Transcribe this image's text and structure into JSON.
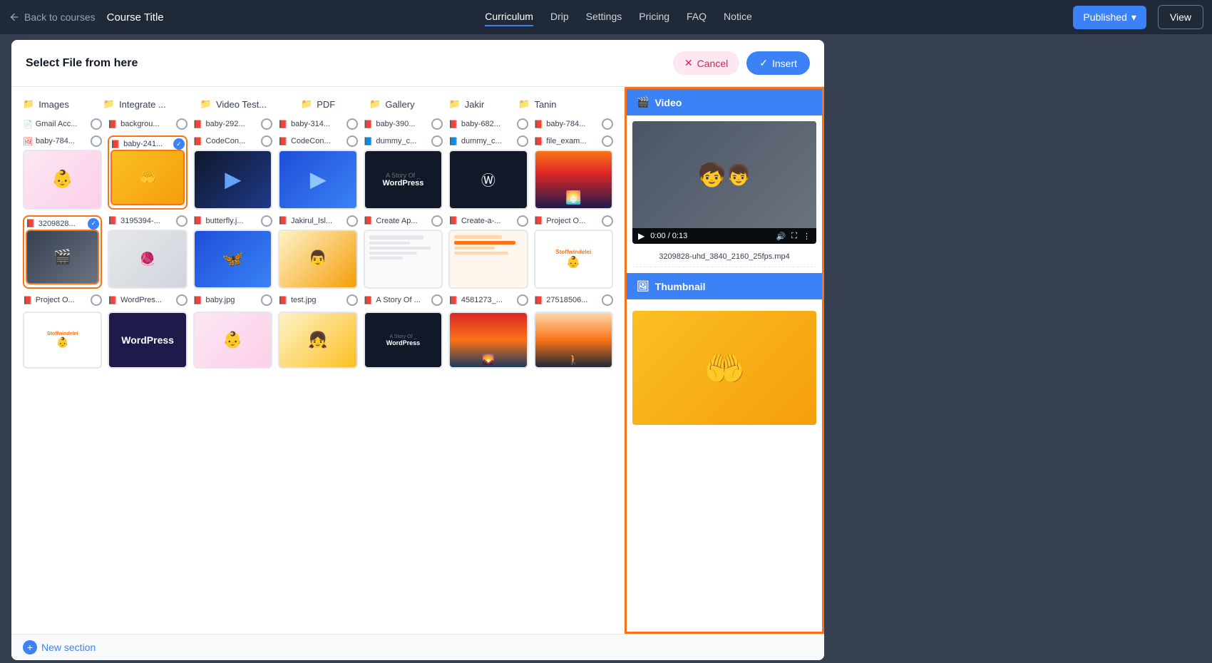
{
  "topnav": {
    "back_label": "Back to courses",
    "course_title": "Course Title",
    "nav_items": [
      {
        "label": "Curriculum",
        "active": true
      },
      {
        "label": "Drip",
        "active": false
      },
      {
        "label": "Settings",
        "active": false
      },
      {
        "label": "Pricing",
        "active": false
      },
      {
        "label": "FAQ",
        "active": false
      },
      {
        "label": "Notice",
        "active": false
      }
    ],
    "published_label": "Published",
    "view_label": "View"
  },
  "modal": {
    "title": "Select File from here",
    "cancel_label": "Cancel",
    "insert_label": "Insert",
    "folders": [
      {
        "name": "Images"
      },
      {
        "name": "Integrate ..."
      },
      {
        "name": "Video Test..."
      },
      {
        "name": "PDF"
      },
      {
        "name": "Gallery"
      },
      {
        "name": "Jakir"
      },
      {
        "name": "Tanin"
      }
    ],
    "files_row1": [
      {
        "name": "Gmail Acc...",
        "type": "file",
        "selected": false,
        "thumb": "plain"
      },
      {
        "name": "backgrou...",
        "type": "pdf",
        "selected": false,
        "thumb": "wordpress"
      },
      {
        "name": "baby-292...",
        "type": "pdf",
        "selected": false,
        "thumb": "baby-sleeping"
      },
      {
        "name": "baby-314...",
        "type": "pdf",
        "selected": false,
        "thumb": "baby-sleeping"
      },
      {
        "name": "baby-390...",
        "type": "pdf",
        "selected": false,
        "thumb": "green-baby"
      },
      {
        "name": "baby-682...",
        "type": "pdf",
        "selected": false,
        "thumb": "baby-warm"
      },
      {
        "name": "baby-784...",
        "type": "pdf",
        "selected": false,
        "thumb": "baby-sleeping"
      }
    ],
    "files_row2": [
      {
        "name": "baby-784...",
        "type": "img",
        "selected": false,
        "thumb": "baby-sleeping-pink",
        "outline": "none"
      },
      {
        "name": "baby-241...",
        "type": "pdf",
        "selected": true,
        "thumb": "baby-hands",
        "outline": "orange"
      },
      {
        "name": "CodeCon...",
        "type": "pdf",
        "selected": false,
        "thumb": "codecon"
      },
      {
        "name": "CodeCon...",
        "type": "pdf",
        "selected": false,
        "thumb": "codecon-blue"
      },
      {
        "name": "dummy_c...",
        "type": "doc",
        "selected": false,
        "thumb": "story"
      },
      {
        "name": "dummy_c...",
        "type": "doc",
        "selected": false,
        "thumb": "story-wp"
      },
      {
        "name": "file_exam...",
        "type": "pdf",
        "selected": false,
        "thumb": "silhouette"
      }
    ],
    "files_row3": [
      {
        "name": "3209828...",
        "type": "pdf",
        "selected": true,
        "thumb": "video-kids",
        "outline": "orange"
      },
      {
        "name": "3195394-...",
        "type": "pdf",
        "selected": false,
        "thumb": "lace"
      },
      {
        "name": "butterfly.j...",
        "type": "pdf",
        "selected": false,
        "thumb": "butterfly"
      },
      {
        "name": "Jakirul_Isl...",
        "type": "pdf",
        "selected": false,
        "thumb": "person"
      },
      {
        "name": "Create Ap...",
        "type": "pdf",
        "selected": false,
        "thumb": "doc-plain"
      },
      {
        "name": "Create-a-...",
        "type": "pdf",
        "selected": false,
        "thumb": "orange-doc"
      },
      {
        "name": "Project O...",
        "type": "pdf",
        "selected": false,
        "thumb": "stoffwindel"
      }
    ],
    "files_row4": [
      {
        "name": "Project O...",
        "type": "pdf",
        "selected": false,
        "thumb": "stoffwindel2"
      },
      {
        "name": "WordPres...",
        "type": "pdf",
        "selected": false,
        "thumb": "wordpress2"
      },
      {
        "name": "baby.jpg",
        "type": "pdf",
        "selected": false,
        "thumb": "baby-yellow"
      },
      {
        "name": "test.jpg",
        "type": "pdf",
        "selected": false,
        "thumb": "plain-gray"
      },
      {
        "name": "A Story Of ...",
        "type": "pdf",
        "selected": false,
        "thumb": "story2"
      },
      {
        "name": "4581273_...",
        "type": "pdf",
        "selected": false,
        "thumb": "sunset2"
      },
      {
        "name": "27518506...",
        "type": "pdf",
        "selected": false,
        "thumb": "silhouette2"
      }
    ],
    "files_row5": [
      {
        "name": "",
        "type": "pdf",
        "selected": false,
        "thumb": "stoffwindel3"
      },
      {
        "name": "",
        "type": "pdf",
        "selected": false,
        "thumb": "wordpress3"
      },
      {
        "name": "",
        "type": "pdf",
        "selected": false,
        "thumb": "baby2"
      },
      {
        "name": "",
        "type": "pdf",
        "selected": false,
        "thumb": "asian-baby"
      },
      {
        "name": "",
        "type": "pdf",
        "selected": false,
        "thumb": "story3"
      },
      {
        "name": "",
        "type": "pdf",
        "selected": false,
        "thumb": "sunset3"
      },
      {
        "name": "",
        "type": "pdf",
        "selected": false,
        "thumb": "silhouette3"
      }
    ]
  },
  "right_panel": {
    "video_section_label": "Video",
    "video_filename": "3209828-uhd_3840_2160_25fps.mp4",
    "video_time": "0:00 / 0:13",
    "thumbnail_section_label": "Thumbnail"
  },
  "new_section": {
    "label": "New section"
  }
}
